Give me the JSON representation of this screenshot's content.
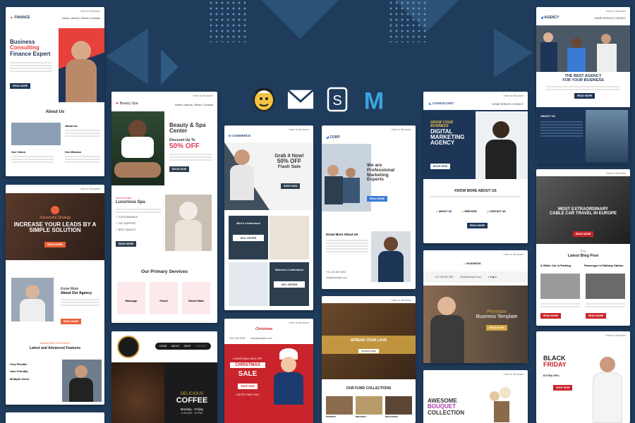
{
  "brand_icons": [
    "mailchimp-icon",
    "mail-icon",
    "stripo-icon",
    "mailerlite-icon"
  ],
  "brand_letters": {
    "stripo": "S",
    "mailerlite": "M"
  },
  "colors": {
    "background": "#1f3c5c",
    "finance_accent": "#e8403a",
    "spa_accent": "#e33a54",
    "coffee_dark": "#1b1b1b",
    "christmas_red": "#c9242b",
    "agency_navy": "#1d3557",
    "consultant_blue": "#2c4f7f"
  },
  "templates": {
    "finance": {
      "logo": "FINANCE",
      "nav": "Home | About | Team | Contact",
      "h1a": "Business",
      "h1b": "Consulting",
      "h1c": "Finance Expert",
      "btn": "READ MORE",
      "about": "About Us",
      "vision": "Our Vision",
      "mission": "Our Mission",
      "aboutus": "About Us"
    },
    "strategy": {
      "tag": "Successful Strategy",
      "h1": "INCREASE YOUR LEADS BY A SIMPLE SOLUTION",
      "know": "Know More",
      "about": "About Our Agency",
      "btn": "READ MORE",
      "sub": "AWESOME FEATURES",
      "feat": "Latest and Advanced Features",
      "f1": "Very Flexible",
      "f2": "User Friendly",
      "f3": "Multiple Users"
    },
    "spa": {
      "logo": "Beauty Spa",
      "nav": "Home | About | Team | Contact",
      "h1": "Beauty & Spa Center",
      "discount": "Discount Up To",
      "off": "50% OFF",
      "btn": "BOOK NOW",
      "newarr": "New Arrivals",
      "lux": "Luxurious Spa",
      "l1": "CUSTOMIZABLE",
      "l2": "24/7 SUPPORT",
      "l3": "BEST QUALITY",
      "btn2": "READ MORE",
      "services": "Our Primary Services",
      "s1": "Massage",
      "s2": "Facial",
      "s3": "Steam Bath"
    },
    "coffee": {
      "nav": [
        "HOME",
        "ABOUT",
        "SHOP",
        "CONTACT"
      ],
      "d1": "DELICIOUS",
      "d2": "COFFEE",
      "hours": "Monday - Friday",
      "time": "6:30 AM - 10 PM"
    },
    "ecommerce": {
      "logo": "E-COMMERCE",
      "h1a": "Grab it Now!",
      "h1b": "50% OFF",
      "h1c": "Flash Sale",
      "btn": "SHOP NOW",
      "men": "Men's Collections",
      "men_off": "50% OFFER",
      "women": "Women's Collections",
      "women_off": "40% OFFER"
    },
    "christmas": {
      "logo": "Christmas",
      "phone": "+012 345 6789",
      "email": "info@example.com",
      "off": "CHRISTMAS 30% OFF",
      "xmas": "CHRISTMAS",
      "sale": "SALE",
      "btn": "SHOP NOW",
      "ltd": "LIMITED TIME ONLY"
    },
    "corp": {
      "logo": "CORP",
      "h1a": "We are",
      "h1b": "Professional",
      "h1c": "Marketing",
      "h1d": "Experts",
      "btn": "READ MORE",
      "know": "Know More About Us",
      "phone": "+01 234 567 8900",
      "email": "info@example.com"
    },
    "fund": {
      "h1": "SPREAD YOUR LOVE",
      "btn": "DONATE NOW",
      "coll": "OUR FUND COLLECTIONS",
      "c1": "POVERTY",
      "c2": "DROUGHT",
      "c3": "EDUCATION"
    },
    "consultant": {
      "logo": "CONSULTANT",
      "nav": "HOME   SERVICE   CONTACT",
      "h1a": "GROW YOUR",
      "h1b": "BUSINESS",
      "h1c": "DIGITAL",
      "h1d": "MARKETING",
      "h1e": "AGENCY",
      "btn": "BOOK NOW",
      "know": "KNOW MORE ABOUT US",
      "a1": "ABOUT US",
      "a2": "SERVICES",
      "a3": "CONTACT US",
      "btn2": "READ MORE"
    },
    "business": {
      "logo": "BUSINESS",
      "phone": "+01 234 567 890",
      "email": "info@example.com",
      "premium": "Premium",
      "h1": "Business Template",
      "btn": "READ MORE"
    },
    "bouquet": {
      "h1a": "AWESOME",
      "h1b": "BOUQUET",
      "h1c": "COLLECTION"
    },
    "agency": {
      "logo": "AGENCY",
      "nav": "HOME   SERVICE   CONTACT",
      "h1a": "THE BEST AGENCY",
      "h1b": "FOR YOUR BUSINESS",
      "btn": "READ MORE",
      "about": "ABOUT US"
    },
    "travel": {
      "h1a": "MOST EXTRAORDINARY",
      "h1b": "CABLE CAR TRAVEL IN EUROPE",
      "btn": "READ MORE",
      "blog_sub": "Blog",
      "blog": "Latest Blog Post",
      "p1": "A White Car in Parking",
      "p2": "Passenger in Railway Station",
      "btn2": "READ MORE"
    },
    "blackfriday": {
      "h1a": "BLACK",
      "h1b": "FRIDAY",
      "extra": "EXTRA 50%",
      "btn": "SHOP NOW"
    },
    "view_browser": "View in Browser"
  }
}
